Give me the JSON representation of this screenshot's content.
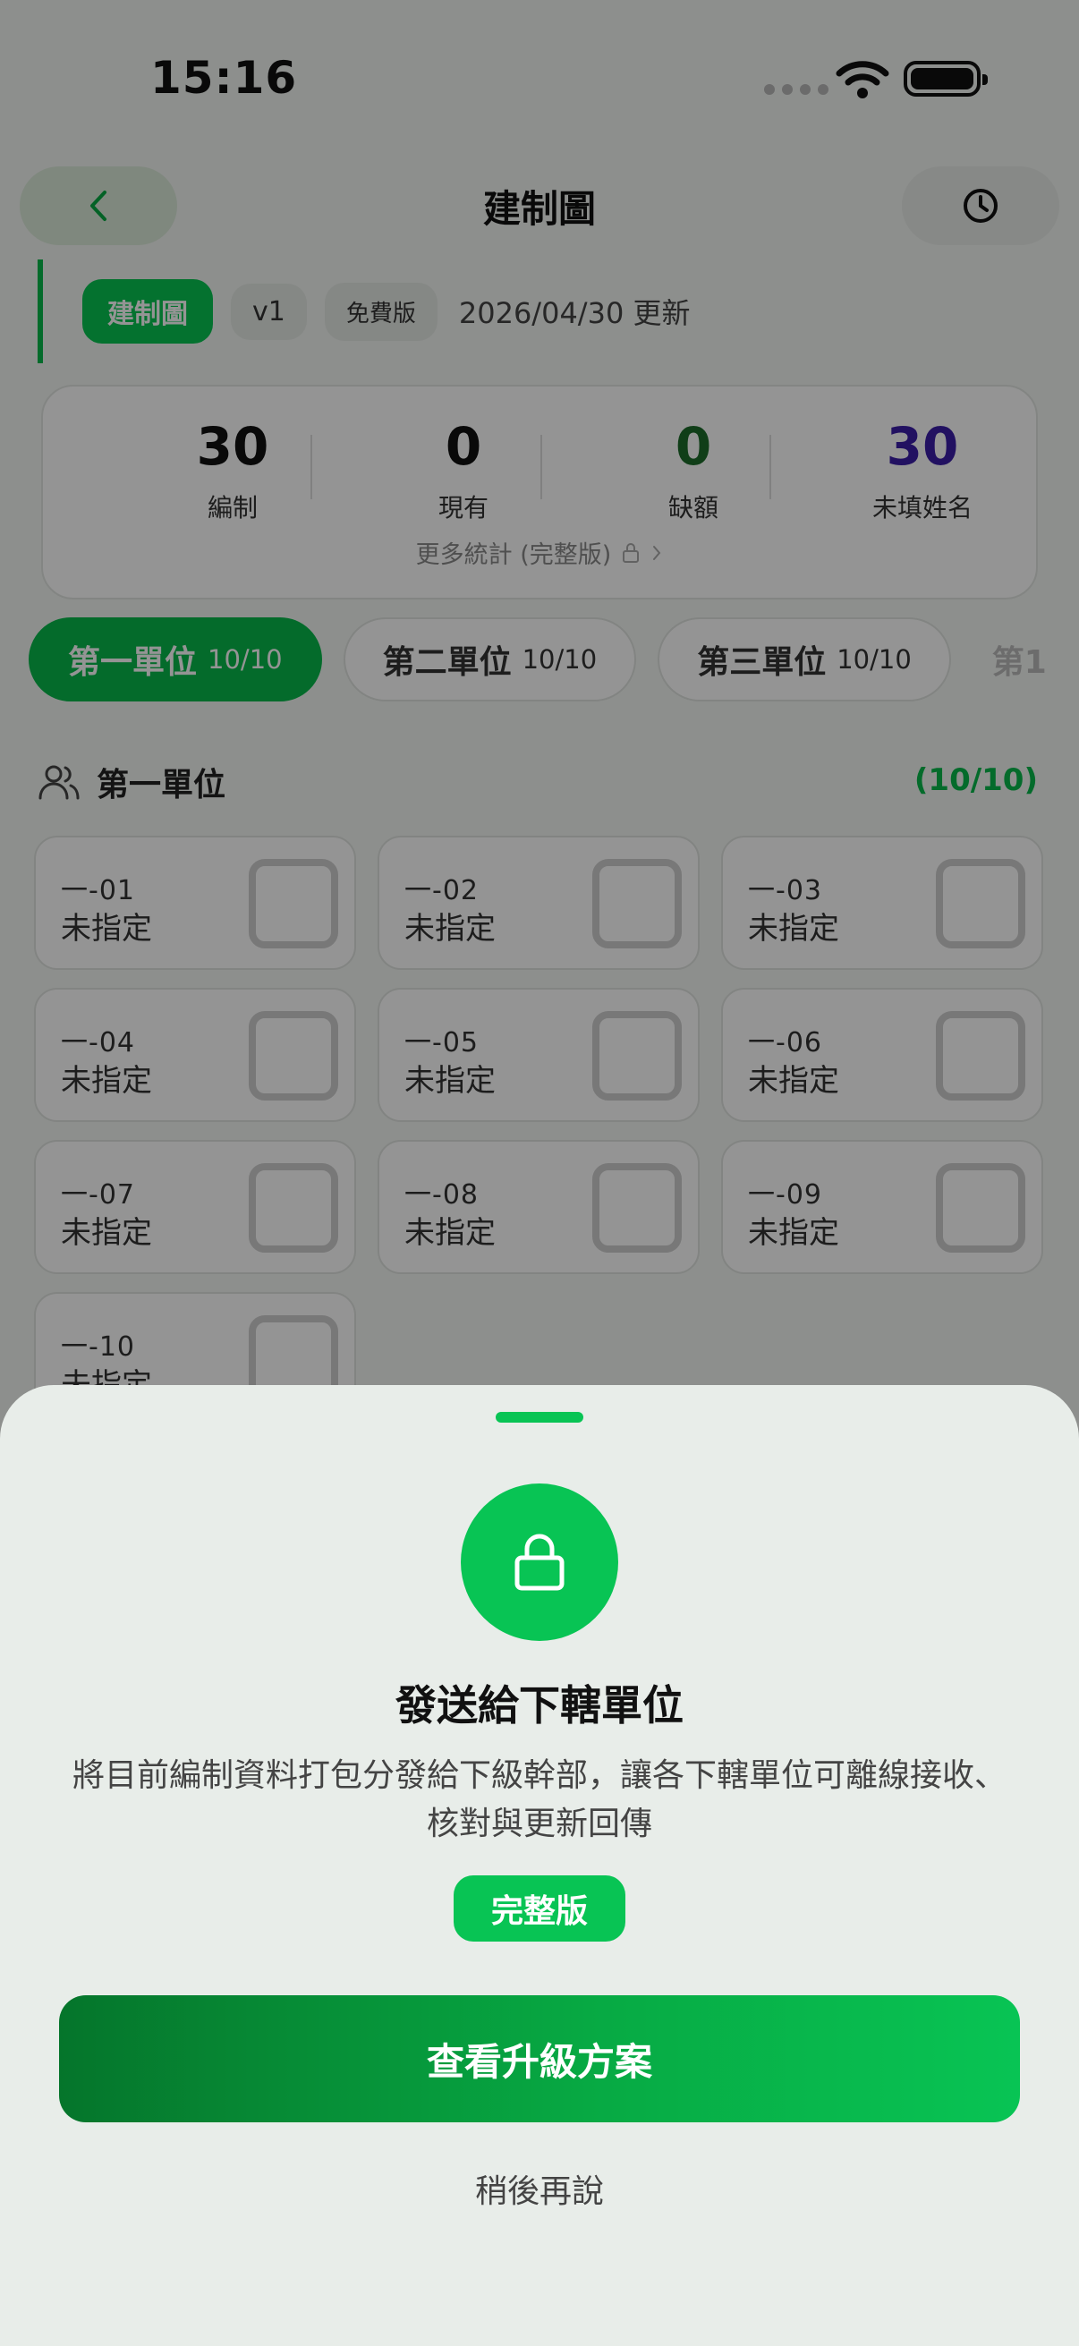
{
  "status_bar": {
    "time": "15:16"
  },
  "header": {
    "title": "建制圖"
  },
  "version_row": {
    "tag": "建制圖",
    "version": "v1",
    "plan": "免費版",
    "updated": "2026/04/30 更新"
  },
  "stats": {
    "items": [
      {
        "value": "30",
        "label": "編制",
        "color": "#111111"
      },
      {
        "value": "0",
        "label": "現有",
        "color": "#111111"
      },
      {
        "value": "0",
        "label": "缺額",
        "color": "#1c6b2a"
      },
      {
        "value": "30",
        "label": "未填姓名",
        "color": "#3b1ea8"
      }
    ],
    "more_link": "更多統計 (完整版)"
  },
  "tabs": [
    {
      "label": "第一單位",
      "count": "10/10"
    },
    {
      "label": "第二單位",
      "count": "10/10"
    },
    {
      "label": "第三單位",
      "count": "10/10"
    },
    {
      "label": "第1"
    }
  ],
  "section": {
    "title": "第一單位",
    "count": "(10/10)"
  },
  "slots": [
    {
      "code": "一-01",
      "name": "未指定"
    },
    {
      "code": "一-02",
      "name": "未指定"
    },
    {
      "code": "一-03",
      "name": "未指定"
    },
    {
      "code": "一-04",
      "name": "未指定"
    },
    {
      "code": "一-05",
      "name": "未指定"
    },
    {
      "code": "一-06",
      "name": "未指定"
    },
    {
      "code": "一-07",
      "name": "未指定"
    },
    {
      "code": "一-08",
      "name": "未指定"
    },
    {
      "code": "一-09",
      "name": "未指定"
    },
    {
      "code": "一-10",
      "name": "未指定"
    }
  ],
  "sheet": {
    "title": "發送給下轄單位",
    "description": "將目前編制資料打包分發給下級幹部，讓各下轄單位可離線接收、核對與更新回傳",
    "badge": "完整版",
    "primary_button": "查看升級方案",
    "secondary_button": "稍後再說"
  },
  "colors": {
    "brand": "#08c454",
    "brand_dark": "#05752b"
  }
}
